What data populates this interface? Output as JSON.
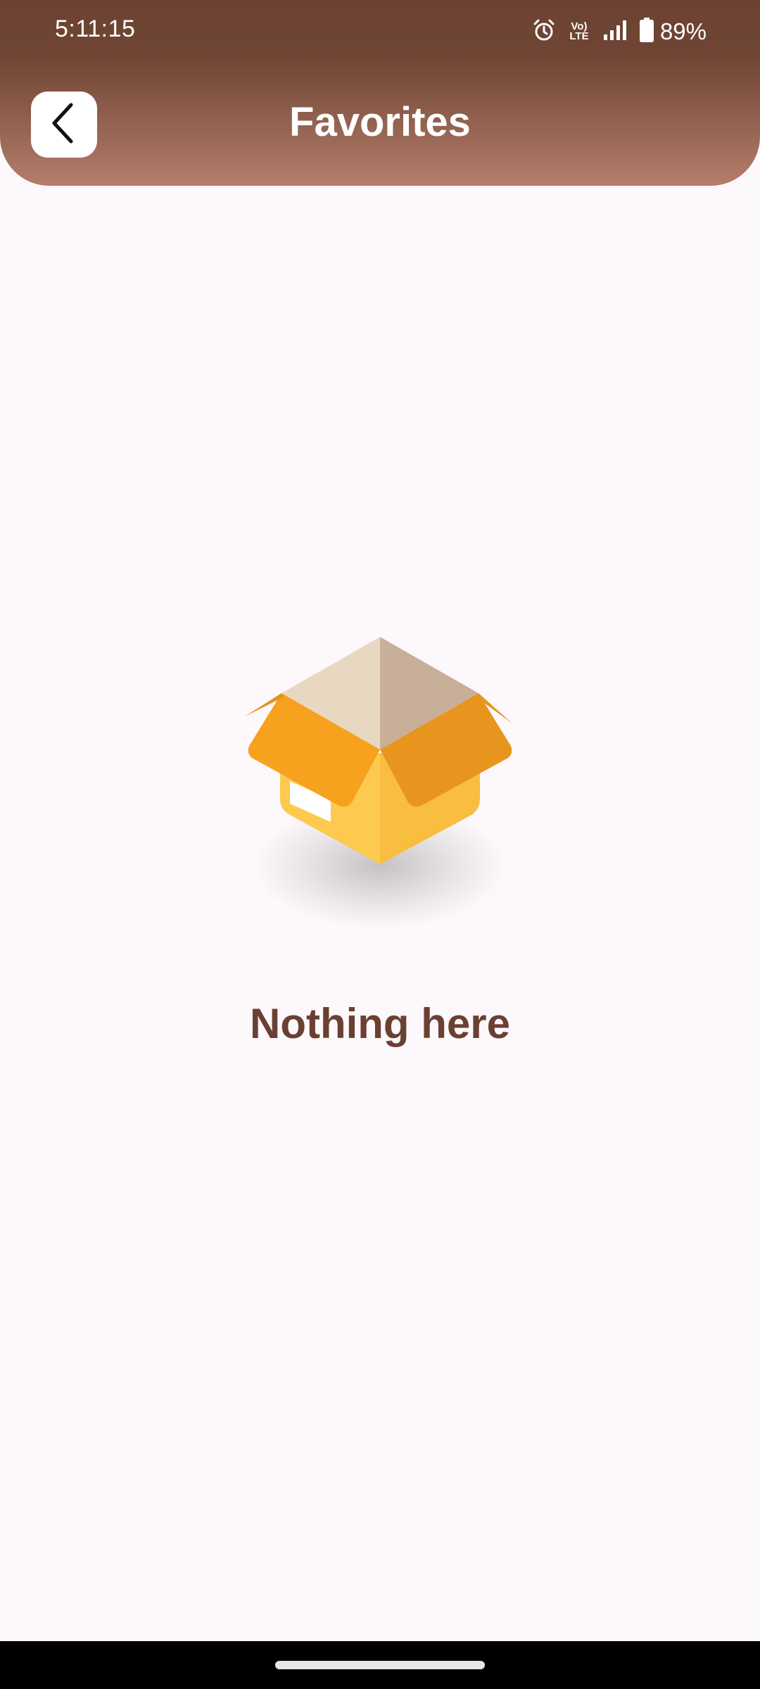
{
  "status_bar": {
    "time": "5:11:15",
    "volte_label": "Vo) LTE",
    "battery_percent": "89%",
    "icons": [
      "alarm-icon",
      "volte-icon",
      "signal-icon",
      "battery-icon"
    ]
  },
  "header": {
    "title": "Favorites",
    "back_icon": "chevron-left-icon"
  },
  "empty_state": {
    "message": "Nothing here",
    "illustration": "open-box-icon"
  },
  "colors": {
    "header_top": "#6d4232",
    "header_bottom": "#b57d6b",
    "background": "#fdf8fb",
    "message_text": "#6a4032"
  }
}
